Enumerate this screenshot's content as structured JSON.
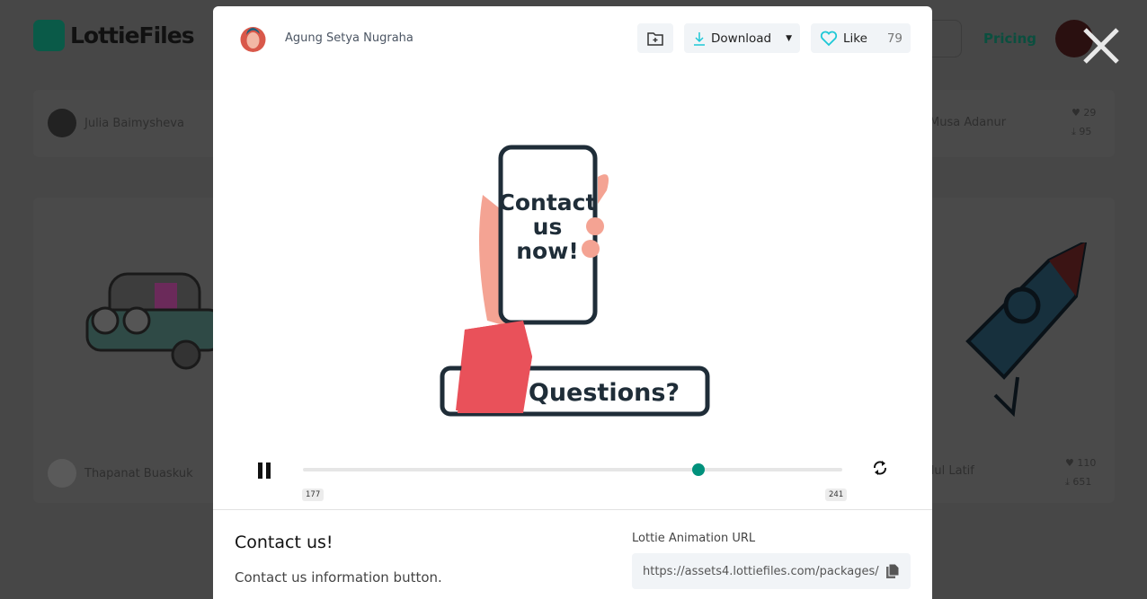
{
  "background": {
    "logo_text": "LottieFiles",
    "pricing": "Pricing",
    "cards": [
      {
        "author": "Julia Baimysheva"
      },
      {
        "author": "Musa Adanur",
        "likes": "29",
        "downloads": "95"
      },
      {
        "author": "Thapanat Buaskuk"
      },
      {
        "author": "Abdul Latif",
        "likes": "110",
        "downloads": "651"
      }
    ]
  },
  "modal": {
    "author": "Agung Setya Nugraha",
    "download_label": "Download",
    "like_label": "Like",
    "like_count": "79",
    "animation_text": {
      "line1": "Contact",
      "line2": "us",
      "line3": "now!",
      "banner": "Questions?"
    },
    "player": {
      "current_frame": "177",
      "total_frames": "241",
      "progress_fraction": 0.734
    },
    "title": "Contact us!",
    "description": "Contact us information button.",
    "url_label": "Lottie Animation URL",
    "url_value": "https://assets4.lottiefiles.com/packages/"
  },
  "colors": {
    "accent": "#00917c",
    "like_icon": "#1ec8d6",
    "overlay": "#474747"
  }
}
